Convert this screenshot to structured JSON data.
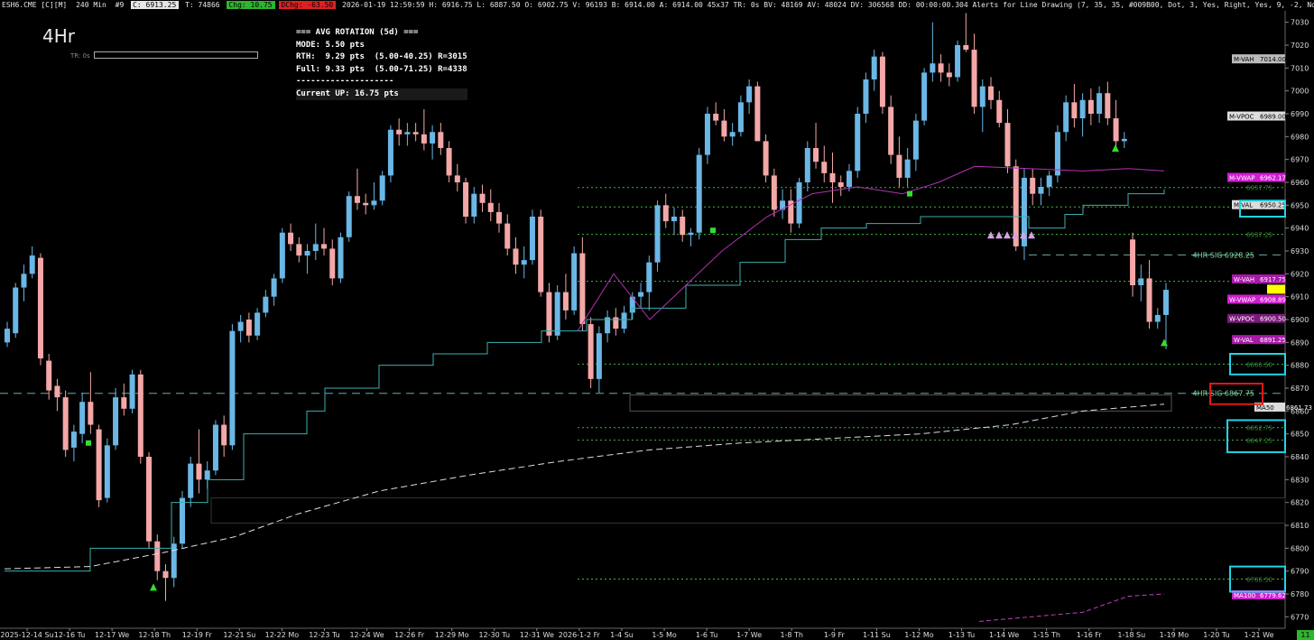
{
  "header": {
    "symbol": "ESH6.CME [C][M]",
    "interval": "240 Min",
    "bar_number": "#9",
    "close": "C: 6913.25",
    "ticks": "T: 74866",
    "chg": "Chg: 10.75",
    "dchg": "DChg: -63.50",
    "info": "2026-01-19 12:59:59 H: 6916.75 L: 6887.50 O: 6902.75 V: 96193 B: 6914.00 A: 6914.00 45x37 TR: 0s BV: 48169 AV: 48024 DV: 306568 DD: 00:00:00.304 Alerts for Line Drawing   (7, 35, 35, #009B00, Dot, 3, Yes, Right, Yes, 9, -2, No, Yes, 50)  Avg Rotation Calc OG (v8)   (1, 20, 5, 09:30:00, 16:00"
  },
  "timeframe_label": "4Hr",
  "tr_label": "TR: 0s",
  "rotation_box": {
    "title": "=== AVG ROTATION (5d) ===",
    "mode": "MODE: 5.50 pts",
    "rth": "RTH:  9.29 pts  (5.00-40.25) R=3015",
    "full": "Full: 9.33 pts  (5.00-71.25) R=4338",
    "divider": "--------------------",
    "current": "Current UP: 16.75 pts"
  },
  "corner_badge": "11",
  "colors": {
    "up": "#6ab7e6",
    "down": "#f4a7a7",
    "green_dotted": "#3dbb3d",
    "teal": "#3ab0b0",
    "magenta": "#b52fb5",
    "box_cyan": "#22d3e6",
    "box_red": "#e01818",
    "background": "#000000"
  },
  "chart_data": {
    "type": "candlestick",
    "y_axis": {
      "min": 6765,
      "max": 7035,
      "ticks": [
        6770,
        6780,
        6790,
        6800,
        6810,
        6820,
        6830,
        6840,
        6850,
        6860,
        6870,
        6880,
        6890,
        6900,
        6910,
        6920,
        6930,
        6940,
        6950,
        6960,
        6970,
        6980,
        6990,
        7000,
        7010,
        7020,
        7030
      ]
    },
    "x_axis_labels": [
      "2025-12-14 Su",
      "12-16 Tu",
      "12-17 We",
      "12-18 Th",
      "12-19 Fr",
      "12-21 Su",
      "12-22 Mo",
      "12-23 Tu",
      "12-24 We",
      "12-26 Fr",
      "12-29 Mo",
      "12-30 Tu",
      "12-31 We",
      "2026-1-2 Fr",
      "1-4 Su",
      "1-5 Mo",
      "1-6 Tu",
      "1-7 We",
      "1-8 Th",
      "1-9 Fr",
      "1-11 Su",
      "1-12 Mo",
      "1-13 Tu",
      "1-14 We",
      "1-15 Th",
      "1-16 Fr",
      "1-18 Su",
      "1-19 Mo",
      "1-20 Tu",
      "1-21 We"
    ],
    "candles": [
      [
        6890,
        6899,
        6888,
        6896
      ],
      [
        6894,
        6916,
        6892,
        6914
      ],
      [
        6914,
        6924,
        6908,
        6920
      ],
      [
        6920,
        6932,
        6918,
        6928
      ],
      [
        6927,
        6929,
        6880,
        6883
      ],
      [
        6882,
        6885,
        6865,
        6869
      ],
      [
        6871,
        6874,
        6860,
        6866
      ],
      [
        6866,
        6869,
        6840,
        6843
      ],
      [
        6844,
        6854,
        6838,
        6851
      ],
      [
        6850,
        6868,
        6846,
        6864
      ],
      [
        6864,
        6877,
        6850,
        6854
      ],
      [
        6852,
        6854,
        6818,
        6821
      ],
      [
        6822,
        6848,
        6820,
        6845
      ],
      [
        6845,
        6870,
        6843,
        6866
      ],
      [
        6866,
        6872,
        6858,
        6861
      ],
      [
        6861,
        6878,
        6859,
        6876
      ],
      [
        6876,
        6878,
        6837,
        6840
      ],
      [
        6840,
        6842,
        6800,
        6803
      ],
      [
        6803,
        6806,
        6786,
        6790
      ],
      [
        6790,
        6793,
        6777,
        6787
      ],
      [
        6787,
        6805,
        6783,
        6802
      ],
      [
        6802,
        6825,
        6800,
        6822
      ],
      [
        6822,
        6840,
        6818,
        6837
      ],
      [
        6837,
        6852,
        6824,
        6830
      ],
      [
        6830,
        6838,
        6826,
        6834
      ],
      [
        6834,
        6856,
        6832,
        6854
      ],
      [
        6854,
        6858,
        6840,
        6845
      ],
      [
        6845,
        6898,
        6843,
        6895
      ],
      [
        6895,
        6902,
        6890,
        6899
      ],
      [
        6900,
        6903,
        6890,
        6893
      ],
      [
        6893,
        6905,
        6891,
        6903
      ],
      [
        6903,
        6913,
        6901,
        6910
      ],
      [
        6910,
        6920,
        6906,
        6918
      ],
      [
        6918,
        6940,
        6916,
        6938
      ],
      [
        6938,
        6942,
        6930,
        6933
      ],
      [
        6933,
        6936,
        6925,
        6928
      ],
      [
        6928,
        6933,
        6920,
        6930
      ],
      [
        6930,
        6942,
        6926,
        6933
      ],
      [
        6933,
        6940,
        6928,
        6931
      ],
      [
        6931,
        6935,
        6915,
        6918
      ],
      [
        6918,
        6938,
        6916,
        6936
      ],
      [
        6936,
        6956,
        6934,
        6954
      ],
      [
        6954,
        6966,
        6948,
        6951
      ],
      [
        6951,
        6955,
        6946,
        6950
      ],
      [
        6950,
        6960,
        6948,
        6952
      ],
      [
        6952,
        6965,
        6950,
        6963
      ],
      [
        6963,
        6985,
        6960,
        6983
      ],
      [
        6983,
        6988,
        6976,
        6981
      ],
      [
        6981,
        6986,
        6976,
        6982
      ],
      [
        6982,
        6986,
        6978,
        6981
      ],
      [
        6981,
        6992,
        6974,
        6977
      ],
      [
        6977,
        6985,
        6970,
        6982
      ],
      [
        6982,
        6986,
        6972,
        6975
      ],
      [
        6975,
        6978,
        6960,
        6963
      ],
      [
        6963,
        6968,
        6956,
        6960
      ],
      [
        6960,
        6962,
        6942,
        6945
      ],
      [
        6945,
        6958,
        6942,
        6955
      ],
      [
        6955,
        6959,
        6947,
        6951
      ],
      [
        6951,
        6957,
        6943,
        6947
      ],
      [
        6947,
        6951,
        6938,
        6942
      ],
      [
        6942,
        6946,
        6928,
        6931
      ],
      [
        6931,
        6936,
        6920,
        6924
      ],
      [
        6924,
        6932,
        6918,
        6926
      ],
      [
        6926,
        6948,
        6924,
        6945
      ],
      [
        6945,
        6948,
        6910,
        6912
      ],
      [
        6912,
        6916,
        6890,
        6893
      ],
      [
        6893,
        6915,
        6891,
        6912
      ],
      [
        6912,
        6920,
        6900,
        6904
      ],
      [
        6904,
        6932,
        6902,
        6929
      ],
      [
        6929,
        6936,
        6895,
        6898
      ],
      [
        6898,
        6901,
        6870,
        6874
      ],
      [
        6874,
        6897,
        6868,
        6894
      ],
      [
        6894,
        6904,
        6890,
        6901
      ],
      [
        6901,
        6905,
        6893,
        6896
      ],
      [
        6896,
        6906,
        6894,
        6903
      ],
      [
        6903,
        6912,
        6900,
        6910
      ],
      [
        6910,
        6916,
        6905,
        6912
      ],
      [
        6912,
        6928,
        6904,
        6925
      ],
      [
        6925,
        6952,
        6921,
        6950
      ],
      [
        6950,
        6955,
        6940,
        6943
      ],
      [
        6943,
        6949,
        6937,
        6945
      ],
      [
        6945,
        6948,
        6934,
        6937
      ],
      [
        6937,
        6940,
        6932,
        6938
      ],
      [
        6938,
        6975,
        6935,
        6972
      ],
      [
        6972,
        6993,
        6968,
        6990
      ],
      [
        6990,
        6995,
        6985,
        6987
      ],
      [
        6987,
        6992,
        6978,
        6980
      ],
      [
        6980,
        6986,
        6976,
        6982
      ],
      [
        6982,
        6998,
        6980,
        6995
      ],
      [
        6995,
        7005,
        6990,
        7002
      ],
      [
        7002,
        7004,
        6980,
        6978
      ],
      [
        6978,
        6981,
        6960,
        6963
      ],
      [
        6963,
        6966,
        6945,
        6948
      ],
      [
        6948,
        6957,
        6944,
        6952
      ],
      [
        6952,
        6957,
        6938,
        6942
      ],
      [
        6942,
        6962,
        6940,
        6960
      ],
      [
        6960,
        6978,
        6956,
        6975
      ],
      [
        6975,
        6986,
        6966,
        6969
      ],
      [
        6969,
        6976,
        6960,
        6964
      ],
      [
        6964,
        6973,
        6951,
        6960
      ],
      [
        6960,
        6963,
        6954,
        6958
      ],
      [
        6958,
        6968,
        6956,
        6965
      ],
      [
        6965,
        6993,
        6962,
        6990
      ],
      [
        6990,
        7008,
        6986,
        7005
      ],
      [
        7005,
        7018,
        7000,
        7015
      ],
      [
        7015,
        7017,
        6990,
        6993
      ],
      [
        6993,
        6998,
        6968,
        6972
      ],
      [
        6972,
        6980,
        6958,
        6962
      ],
      [
        6962,
        6975,
        6958,
        6970
      ],
      [
        6970,
        6990,
        6965,
        6987
      ],
      [
        6987,
        7010,
        6985,
        7008
      ],
      [
        7008,
        7030,
        7004,
        7012
      ],
      [
        7012,
        7016,
        7004,
        7008
      ],
      [
        7008,
        7012,
        7002,
        7006
      ],
      [
        7006,
        7022,
        7004,
        7020
      ],
      [
        7020,
        7034,
        7017,
        7018
      ],
      [
        7018,
        7025,
        6990,
        6993
      ],
      [
        6993,
        7005,
        6982,
        7002
      ],
      [
        7002,
        7006,
        6992,
        6996
      ],
      [
        6996,
        7000,
        6984,
        6986
      ],
      [
        6986,
        6992,
        6964,
        6967
      ],
      [
        6967,
        6970,
        6930,
        6932
      ],
      [
        6932,
        6966,
        6926,
        6962
      ],
      [
        6962,
        6966,
        6950,
        6955
      ],
      [
        6955,
        6962,
        6950,
        6958
      ],
      [
        6958,
        6965,
        6954,
        6963
      ],
      [
        6963,
        6985,
        6960,
        6982
      ],
      [
        6982,
        6998,
        6978,
        6995
      ],
      [
        6995,
        7003,
        6984,
        6988
      ],
      [
        6988,
        6999,
        6980,
        6996
      ],
      [
        6996,
        7001,
        6985,
        6990
      ],
      [
        6990,
        7002,
        6986,
        6999
      ],
      [
        6999,
        7004,
        6985,
        6988
      ],
      [
        6988,
        6996,
        6975,
        6978
      ],
      [
        6978,
        6982,
        6975,
        6979
      ],
      [
        6935,
        6938,
        6910,
        6915
      ],
      [
        6915,
        6924,
        6908,
        6918
      ],
      [
        6918,
        6926,
        6896,
        6899
      ],
      [
        6899,
        6905,
        6896,
        6902
      ],
      [
        6902,
        6916,
        6887,
        6913
      ]
    ],
    "levels": [
      {
        "label": "M-VAH",
        "value": 7014.0
      },
      {
        "label": "M-VPOC",
        "value": 6989.0
      },
      {
        "label": "M-VWAP",
        "value": 6962.17
      },
      {
        "label": "M-VAL",
        "value": 6950.25
      },
      {
        "label": "W-VAH",
        "value": 6917.75
      },
      {
        "label": "W-VWAP",
        "value": 6908.89
      },
      {
        "label": "W-VPOC",
        "value": 6900.5
      },
      {
        "label": "W-VAL",
        "value": 6891.25
      },
      {
        "label": "4HR SIG",
        "value": 6928.25
      },
      {
        "label": "4HR SIG",
        "value": 6867.75
      },
      {
        "label": "MA100",
        "value": 6779.62
      },
      {
        "label": "MA50",
        "value": 6861.73
      },
      {
        "label": "Last",
        "value": 6913.25
      }
    ],
    "dotted_levels": [
      6957.75,
      6949.25,
      6937.25,
      6916.75,
      6880.5,
      6852.75,
      6847.25,
      6786.5
    ]
  }
}
